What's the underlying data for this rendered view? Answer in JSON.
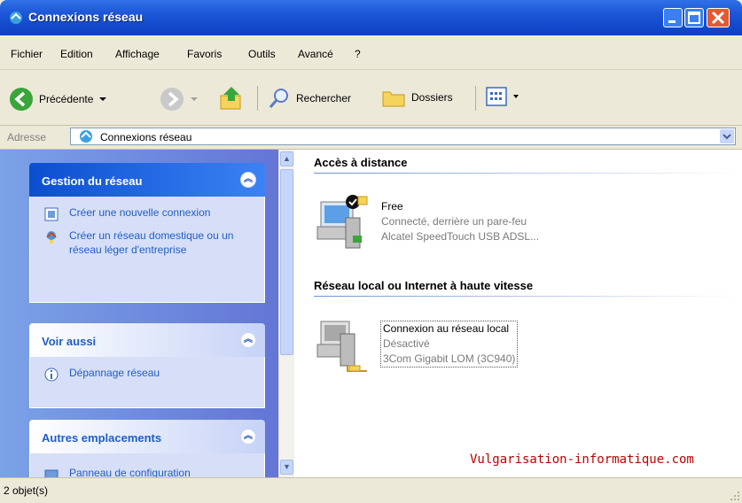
{
  "window": {
    "title": "Connexions réseau"
  },
  "menu": [
    "Fichier",
    "Edition",
    "Affichage",
    "Favoris",
    "Outils",
    "Avancé",
    "?"
  ],
  "toolbar": {
    "back": "Précédente",
    "search": "Rechercher",
    "folders": "Dossiers"
  },
  "address": {
    "label": "Adresse",
    "value": "Connexions réseau"
  },
  "sidebar": {
    "network_tasks": {
      "title": "Gestion du réseau",
      "items": [
        "Créer une nouvelle connexion",
        "Créer un réseau domestique ou un réseau léger d'entreprise"
      ]
    },
    "see_also": {
      "title": "Voir aussi",
      "items": [
        "Dépannage réseau"
      ]
    },
    "other_places": {
      "title": "Autres emplacements",
      "items": [
        "Panneau de configuration"
      ]
    }
  },
  "content": {
    "remote": {
      "title": "Accès à distance",
      "name": "Free",
      "line1": "Connecté, derrière un pare-feu",
      "line2": "Alcatel SpeedTouch USB ADSL..."
    },
    "lan": {
      "title": "Réseau local ou Internet à haute vitesse",
      "name": "Connexion au réseau local",
      "line1": "Désactivé",
      "line2": "3Com Gigabit LOM (3C940)"
    },
    "watermark": "Vulgarisation-informatique.com"
  },
  "status": {
    "text": "2 objet(s)"
  }
}
